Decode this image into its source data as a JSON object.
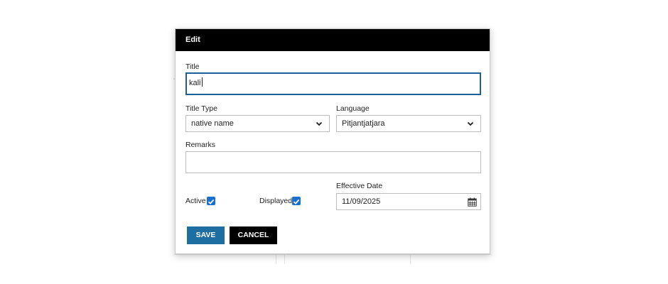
{
  "modal": {
    "header_title": "Edit",
    "title": {
      "label": "Title",
      "value": "kali"
    },
    "title_type": {
      "label": "Title Type",
      "value": "native name"
    },
    "language": {
      "label": "Language",
      "value": "Pitjantjatjara"
    },
    "remarks": {
      "label": "Remarks",
      "value": ""
    },
    "active": {
      "label": "Active",
      "checked": true
    },
    "displayed": {
      "label": "Displayed",
      "checked": true
    },
    "effective_date": {
      "label": "Effective Date",
      "value": "11/09/2025"
    },
    "save_label": "SAVE",
    "cancel_label": "CANCEL"
  },
  "colors": {
    "header_bg": "#000000",
    "focus_border": "#1f5f99",
    "save_button": "#1f6ea1",
    "cancel_button": "#000000",
    "checkbox": "#1a6fd1"
  },
  "icons": [
    "chevron-down-icon",
    "calendar-icon",
    "checkmark-icon"
  ]
}
